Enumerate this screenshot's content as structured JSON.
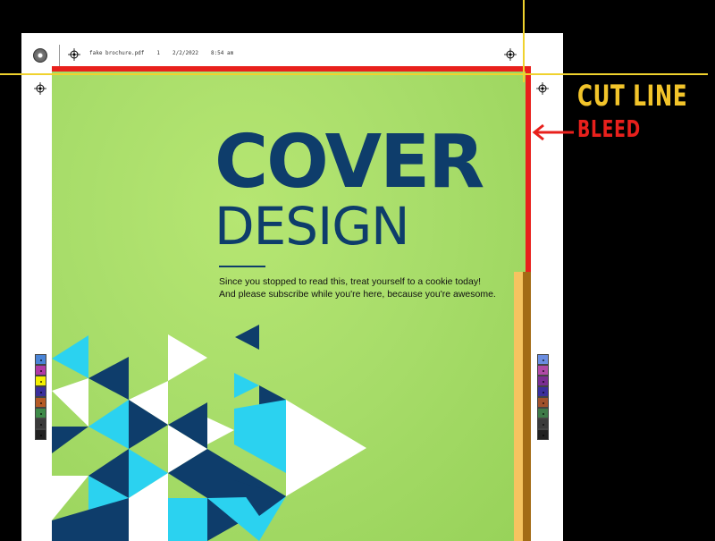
{
  "slug": {
    "filename": "fake brochure.pdf",
    "page": "1",
    "date": "2/2/2022",
    "time": "8:54 am"
  },
  "cover": {
    "title": "COVER",
    "subtitle": "DESIGN",
    "tagline_line1": "Since you stopped to read this, treat yourself to a cookie today!",
    "tagline_line2": "And please subscribe while you're here, because you're awesome."
  },
  "annotations": {
    "cut_label": "CUT LINE",
    "bleed_label": "BLEED"
  },
  "colors": {
    "cover_bg": "#a8dd6a",
    "navy": "#0e3d6b",
    "cyan": "#2bd2f0",
    "bleed": "#e8201c",
    "cut": "#f0d22e",
    "white": "#ffffff"
  },
  "icons": {
    "registration": "registration-mark-icon",
    "arrow": "arrow-left-icon"
  },
  "color_bars": {
    "left": [
      "#4a84d6",
      "#b03aa6",
      "#f4f000",
      "#3b2f9c",
      "#b55a26",
      "#3f8a49",
      "#3a3a3a",
      "#222222"
    ],
    "right": [
      "#6b8de0",
      "#b04aa6",
      "#7a2e92",
      "#3b2f9c",
      "#a0522d",
      "#3f7a49",
      "#3a3a3a",
      "#222222"
    ]
  }
}
